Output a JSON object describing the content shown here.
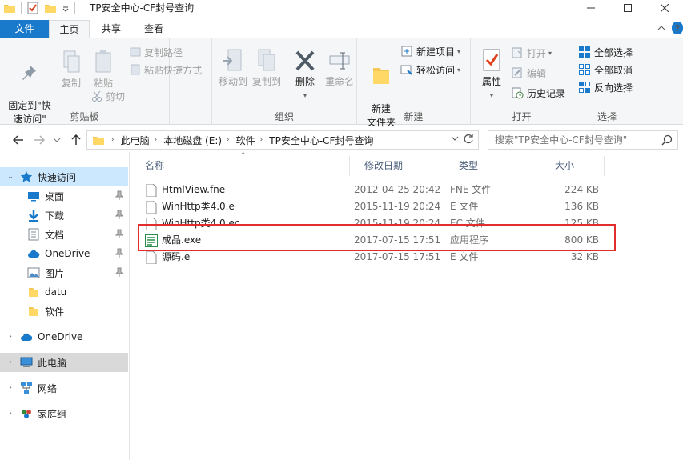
{
  "window": {
    "title": "TP安全中心-CF封号查询"
  },
  "ribbon_tabs": [
    {
      "label": "文件"
    },
    {
      "label": "主页"
    },
    {
      "label": "共享"
    },
    {
      "label": "查看"
    }
  ],
  "ribbon": {
    "clipboard": {
      "group_label": "剪贴板",
      "pin_quick": "固定到\"快\n速访问\"",
      "copy": "复制",
      "paste": "粘贴",
      "copy_path": "复制路径",
      "paste_shortcut": "粘贴快捷方式",
      "cut": "剪切"
    },
    "organize": {
      "group_label": "组织",
      "move_to": "移动到",
      "copy_to": "复制到",
      "delete": "删除",
      "rename": "重命名"
    },
    "new": {
      "group_label": "新建",
      "new_folder": "新建\n文件夹",
      "new_item": "新建项目",
      "easy_access": "轻松访问"
    },
    "open": {
      "group_label": "打开",
      "properties": "属性",
      "open": "打开",
      "edit": "编辑",
      "history": "历史记录"
    },
    "select": {
      "group_label": "选择",
      "select_all": "全部选择",
      "select_none": "全部取消",
      "invert": "反向选择"
    }
  },
  "address": {
    "crumbs": [
      "此电脑",
      "本地磁盘 (E:)",
      "软件",
      "TP安全中心-CF封号查询"
    ]
  },
  "search": {
    "placeholder": "搜索\"TP安全中心-CF封号查询\""
  },
  "nav": {
    "quick_access": "快速访问",
    "items": [
      {
        "label": "桌面",
        "icon": "desktop-icon"
      },
      {
        "label": "下载",
        "icon": "download-icon"
      },
      {
        "label": "文档",
        "icon": "document-icon"
      },
      {
        "label": "OneDrive",
        "icon": "onedrive-icon"
      },
      {
        "label": "图片",
        "icon": "pictures-icon"
      },
      {
        "label": "datu",
        "icon": "folder-icon"
      },
      {
        "label": "软件",
        "icon": "folder-icon"
      }
    ],
    "onedrive": "OneDrive",
    "this_pc": "此电脑",
    "network": "网络",
    "homegroup": "家庭组"
  },
  "columns": {
    "name": "名称",
    "date": "修改日期",
    "type": "类型",
    "size": "大小"
  },
  "files": [
    {
      "name": "HtmlView.fne",
      "date": "2012-04-25 20:42",
      "type": "FNE 文件",
      "size": "224 KB"
    },
    {
      "name": "WinHttp类4.0.e",
      "date": "2015-11-19 20:24",
      "type": "E 文件",
      "size": "136 KB"
    },
    {
      "name": "WinHttp类4.0.ec",
      "date": "2015-11-19 20:24",
      "type": "EC 文件",
      "size": "125 KB"
    },
    {
      "name": "成品.exe",
      "date": "2017-07-15 17:51",
      "type": "应用程序",
      "size": "800 KB"
    },
    {
      "name": "源码.e",
      "date": "2017-07-15 17:51",
      "type": "E 文件",
      "size": "32 KB"
    }
  ],
  "colors": {
    "accent": "#1979ca",
    "highlight_box": "#e22d2d",
    "selected_nav": "#cce8ff"
  }
}
